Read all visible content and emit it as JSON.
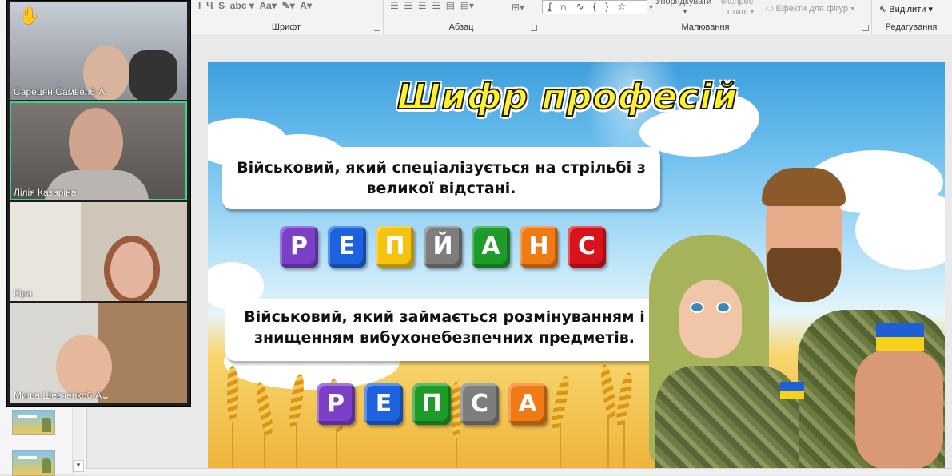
{
  "ribbon": {
    "groups": {
      "font": "Шрифт",
      "paragraph": "Абзац",
      "drawing": "Малювання",
      "editing": "Редагування"
    },
    "arrange_label": "Упорядкувати",
    "express_styles_label": "Експрес-стилі",
    "express_line1": "експрес",
    "express_line2": "стилі",
    "shape_effects_label": "Ефекти для фігур",
    "select_label": "Виділити"
  },
  "slide": {
    "title": "Шифр професій",
    "question1": "Військовий, який спеціалізується на стрільбі з великої відстані.",
    "question2": "Військовий, який займається розмінуванням і знищенням вибухонебезпечних предметів.",
    "tiles1": [
      "Р",
      "Е",
      "П",
      "Й",
      "А",
      "Н",
      "С"
    ],
    "tiles2": [
      "Р",
      "Е",
      "П",
      "С",
      "А"
    ],
    "colors": {
      "purple": "#7b3fc8",
      "blue": "#1d63e0",
      "yellow": "#f5c20d",
      "grey": "#7d7d7d",
      "green": "#1d9c2a",
      "orange": "#f07a14",
      "red": "#d9131b"
    }
  },
  "video": {
    "participants": [
      {
        "name": "Сарецян Самвел6-А"
      },
      {
        "name": "Лілія Казаріна"
      },
      {
        "name": "Кіра"
      },
      {
        "name": "Миша Шевченко6-А"
      }
    ],
    "raised_hand_icon": "raised-hand-icon"
  }
}
